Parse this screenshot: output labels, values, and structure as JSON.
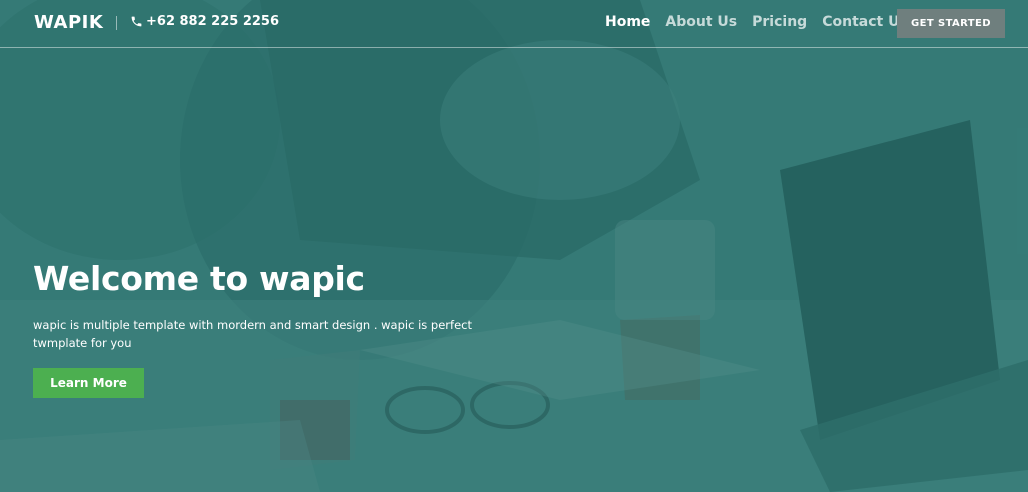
{
  "header": {
    "logo": "WAPIK",
    "phone": "+62 882 225 2256",
    "nav": [
      {
        "label": "Home",
        "active": true
      },
      {
        "label": "About Us",
        "active": false
      },
      {
        "label": "Pricing",
        "active": false
      },
      {
        "label": "Contact Us",
        "active": false
      }
    ],
    "cta_label": "GET STARTED"
  },
  "hero": {
    "title": "Welcome to wapic",
    "description": "wapic is multiple template with mordern and smart design . wapic is perfect twmplate for you",
    "button_label": "Learn More"
  },
  "colors": {
    "overlay": "#246e6a",
    "primary_button": "#4caf50",
    "cta_button": "#6f7f7e"
  },
  "icons": {
    "phone": "phone-icon"
  }
}
